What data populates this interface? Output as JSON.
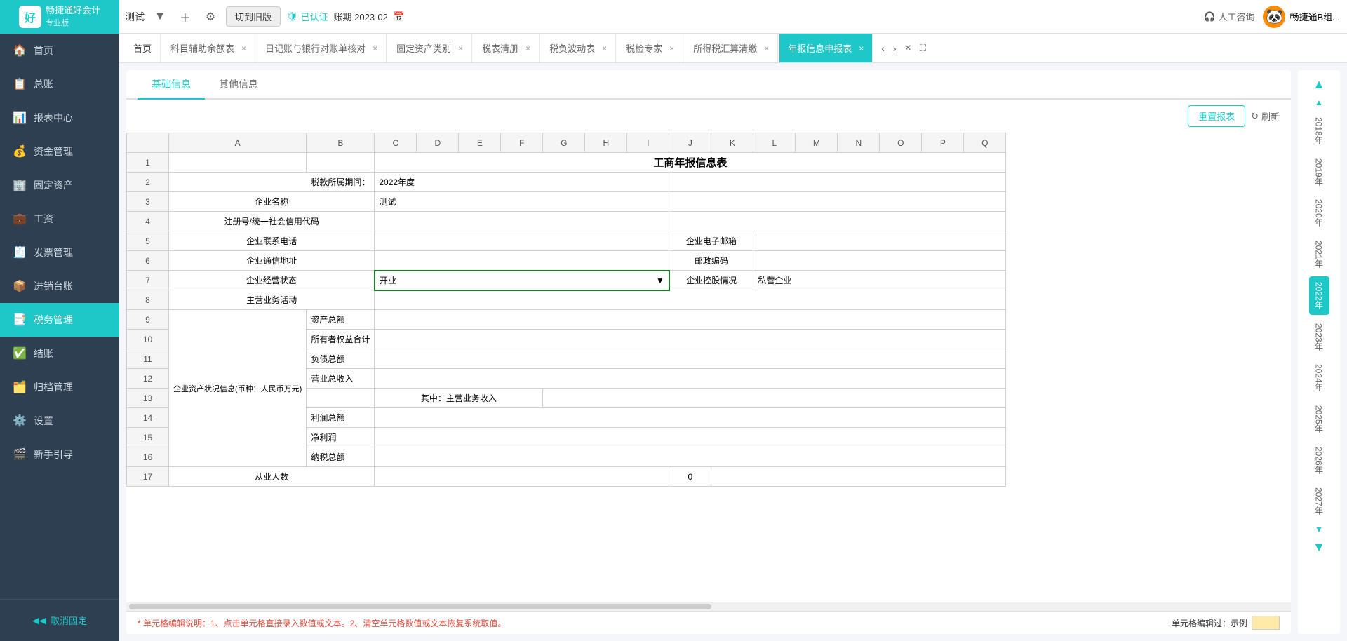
{
  "header": {
    "logo_text": "畅捷通好会计",
    "logo_sub": "专业版",
    "test_label": "测试",
    "old_version_btn": "切到旧版",
    "certified_label": "已认证",
    "period_label": "账期",
    "period_value": "2023-02",
    "consult_label": "人工咨询",
    "user_name": "畅捷通B组..."
  },
  "tabs": [
    {
      "id": "home",
      "label": "首页",
      "closable": false
    },
    {
      "id": "aux",
      "label": "科目辅助余额表",
      "closable": true
    },
    {
      "id": "journal",
      "label": "日记账与银行对账单核对",
      "closable": true
    },
    {
      "id": "fixed",
      "label": "固定资产类别",
      "closable": true
    },
    {
      "id": "tax_clear",
      "label": "税表清册",
      "closable": true
    },
    {
      "id": "tax_wave",
      "label": "税负波动表",
      "closable": true
    },
    {
      "id": "tax_expert",
      "label": "税检专家",
      "closable": true
    },
    {
      "id": "income_tax",
      "label": "所得税汇算清缴",
      "closable": true
    },
    {
      "id": "annual",
      "label": "年报信息申报表",
      "closable": true,
      "active": true
    }
  ],
  "sidebar": {
    "items": [
      {
        "id": "home",
        "label": "首页",
        "icon": "🏠"
      },
      {
        "id": "general",
        "label": "总账",
        "icon": "📋"
      },
      {
        "id": "reports",
        "label": "报表中心",
        "icon": "📊"
      },
      {
        "id": "funds",
        "label": "资金管理",
        "icon": "💰"
      },
      {
        "id": "assets",
        "label": "固定资产",
        "icon": "🏢"
      },
      {
        "id": "salary",
        "label": "工资",
        "icon": "💼"
      },
      {
        "id": "invoice",
        "label": "发票管理",
        "icon": "🧾"
      },
      {
        "id": "sales",
        "label": "进销台账",
        "icon": "📦"
      },
      {
        "id": "tax",
        "label": "税务管理",
        "icon": "📑",
        "active": true
      },
      {
        "id": "settle",
        "label": "结账",
        "icon": "✅"
      },
      {
        "id": "archive",
        "label": "归档管理",
        "icon": "🗂️"
      },
      {
        "id": "settings",
        "label": "设置",
        "icon": "⚙️"
      },
      {
        "id": "guide",
        "label": "新手引导",
        "icon": "🎬"
      }
    ],
    "cancel_fixed": "取消固定"
  },
  "sub_tabs": [
    {
      "id": "basic",
      "label": "基础信息",
      "active": true
    },
    {
      "id": "other",
      "label": "其他信息"
    }
  ],
  "toolbar": {
    "reset_btn": "重置报表",
    "refresh_btn": "刷新"
  },
  "spreadsheet": {
    "title": "工商年报信息表",
    "columns": [
      "A",
      "B",
      "C",
      "D",
      "E",
      "F",
      "G",
      "H",
      "I",
      "J",
      "K",
      "L",
      "M",
      "N",
      "O",
      "P",
      "Q"
    ],
    "rows": [
      {
        "row": 1,
        "cells": [
          {
            "col": "C",
            "span": 15,
            "value": "工商年报信息表",
            "class": "title"
          }
        ]
      },
      {
        "row": 2,
        "cells": [
          {
            "col": "A",
            "span": 2,
            "value": "税款所属期间：",
            "align": "right"
          },
          {
            "col": "C",
            "span": 5,
            "value": "2022年度"
          }
        ]
      },
      {
        "row": 3,
        "cells": [
          {
            "col": "A",
            "span": 2,
            "value": "企业名称",
            "align": "center"
          },
          {
            "col": "C",
            "span": 5,
            "value": "测试"
          }
        ]
      },
      {
        "row": 4,
        "cells": [
          {
            "col": "A",
            "span": 2,
            "value": "注册号/统一社会信用代码",
            "align": "center"
          }
        ]
      },
      {
        "row": 5,
        "cells": [
          {
            "col": "A",
            "span": 2,
            "value": "企业联系电话",
            "align": "center"
          },
          {
            "col": "J",
            "span": 2,
            "value": "企业电子邮箱",
            "align": "center"
          }
        ]
      },
      {
        "row": 6,
        "cells": [
          {
            "col": "A",
            "span": 2,
            "value": "企业通信地址",
            "align": "center"
          },
          {
            "col": "J",
            "span": 2,
            "value": "邮政编码",
            "align": "center"
          }
        ]
      },
      {
        "row": 7,
        "cells": [
          {
            "col": "A",
            "span": 2,
            "value": "企业经营状态",
            "align": "center"
          },
          {
            "col": "C",
            "span": 7,
            "value": "开业",
            "dropdown": true,
            "selected": true
          },
          {
            "col": "J",
            "span": 2,
            "value": "企业控股情况",
            "align": "center"
          },
          {
            "col": "L",
            "span": 5,
            "value": "私营企业"
          }
        ]
      },
      {
        "row": 8,
        "cells": [
          {
            "col": "A",
            "span": 2,
            "value": "主营业务活动",
            "align": "center"
          }
        ]
      },
      {
        "row": 9,
        "cells": [
          {
            "col": "B",
            "value": "资产总额"
          }
        ]
      },
      {
        "row": 10,
        "cells": [
          {
            "col": "B",
            "value": "所有者权益合计"
          }
        ]
      },
      {
        "row": 11,
        "cells": [
          {
            "col": "B",
            "value": "负债总额"
          }
        ]
      },
      {
        "row": 12,
        "cells": [
          {
            "col": "A",
            "span": 1,
            "value": "企业资产状况信息(币种：人民币万元)",
            "rowspan": 4,
            "align": "center"
          },
          {
            "col": "B",
            "value": "营业总收入"
          }
        ]
      },
      {
        "row": 13,
        "cells": [
          {
            "col": "C",
            "span": 4,
            "value": "其中：主营业务收入"
          }
        ]
      },
      {
        "row": 14,
        "cells": [
          {
            "col": "B",
            "value": "利润总额"
          }
        ]
      },
      {
        "row": 15,
        "cells": [
          {
            "col": "B",
            "value": "净利润"
          }
        ]
      },
      {
        "row": 16,
        "cells": [
          {
            "col": "B",
            "value": "纳税总额"
          }
        ]
      },
      {
        "row": 17,
        "cells": [
          {
            "col": "A",
            "span": 2,
            "value": "从业人数",
            "align": "center"
          },
          {
            "col": "J",
            "value": "0",
            "align": "center"
          }
        ]
      }
    ]
  },
  "years": [
    {
      "year": "2018年",
      "active": false
    },
    {
      "year": "2019年",
      "active": false
    },
    {
      "year": "2020年",
      "active": false
    },
    {
      "year": "2021年",
      "active": false
    },
    {
      "year": "2022年",
      "active": true
    },
    {
      "year": "2023年",
      "active": false
    },
    {
      "year": "2024年",
      "active": false
    },
    {
      "year": "2025年",
      "active": false
    },
    {
      "year": "2026年",
      "active": false
    },
    {
      "year": "2027年",
      "active": false
    }
  ],
  "bottom_bar": {
    "note": "* 单元格编辑说明：1、点击单元格直接录入数值或文本。2、清空单元格数值或文本恢复系统取值。",
    "example_label": "单元格编辑过：示例"
  }
}
